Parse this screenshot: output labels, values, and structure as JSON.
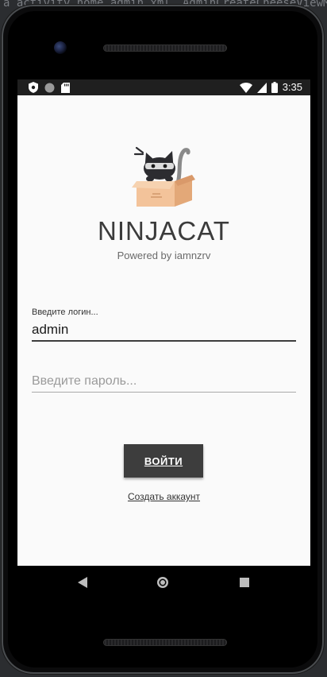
{
  "ide": {
    "left_text": "a activity_home_admin.xml",
    "right_text": "AdminCreateCheeseViewM"
  },
  "status_bar": {
    "time": "3:35",
    "left_icons": [
      "shield-icon",
      "circle-icon",
      "sd-card-icon"
    ],
    "right_icons": [
      "wifi-icon",
      "signal-icon",
      "battery-icon"
    ]
  },
  "app": {
    "title": "NINJACAT",
    "subtitle": "Powered by iamnzrv",
    "logo": "ninja-cat-in-box-logo"
  },
  "form": {
    "login_label": "Введите логин...",
    "login_value": "admin",
    "password_placeholder": "Введите пароль...",
    "password_value": "",
    "login_button": "ВОЙТИ",
    "register_link": "Создать аккаунт"
  },
  "nav": {
    "buttons": [
      "back-icon",
      "home-icon",
      "recent-apps-icon"
    ]
  },
  "colors": {
    "screen_background": "#fafafa",
    "status_bar": "#1f1f1f",
    "button": "#3d3d3d",
    "title_text": "#3b3b3b"
  }
}
